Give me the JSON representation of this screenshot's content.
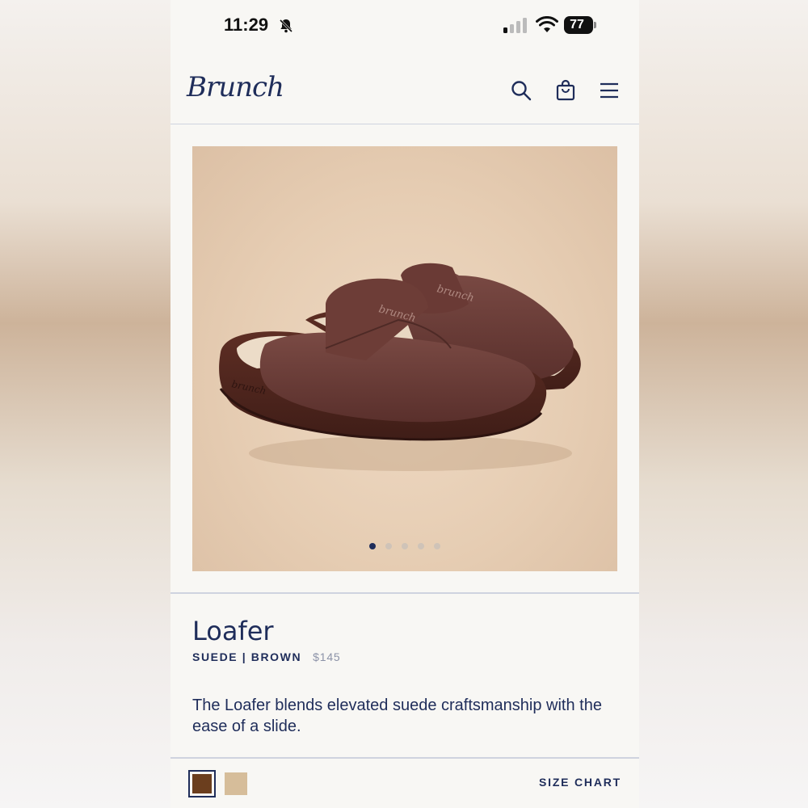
{
  "status_bar": {
    "time": "11:29",
    "battery": "77",
    "icons": [
      "bell-slash-icon",
      "signal-icon",
      "wifi-icon",
      "battery-icon"
    ]
  },
  "header": {
    "logo": "Brunch",
    "icons": [
      "search-icon",
      "shopping-bag-icon",
      "hamburger-menu-icon"
    ]
  },
  "gallery": {
    "image": "brown suede loafer slide pair",
    "image_text": "brunch",
    "slide_count": 5,
    "active_slide": 1
  },
  "product": {
    "title": "Loafer",
    "variant": "SUEDE | BROWN",
    "price": "$145",
    "description": "The Loafer blends elevated suede craftsmanship with the ease of a slide."
  },
  "options": {
    "swatches": [
      {
        "name": "brown",
        "color": "#6b3e1e",
        "selected": true
      },
      {
        "name": "tan",
        "color": "#d6bd9a",
        "selected": false
      }
    ],
    "size_chart_label": "SIZE CHART"
  },
  "colors": {
    "brand_navy": "#1f2d5a",
    "background": "#f8f7f4"
  }
}
